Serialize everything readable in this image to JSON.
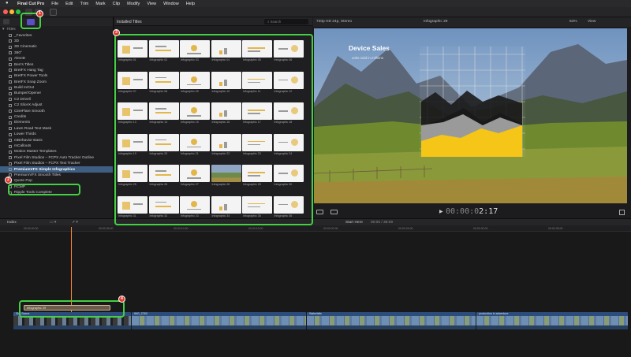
{
  "menubar": {
    "app_name": "Final Cut Pro",
    "items": [
      "File",
      "Edit",
      "Trim",
      "Mark",
      "Clip",
      "Modify",
      "View",
      "Window",
      "Help"
    ]
  },
  "sidebar": {
    "root_label": "Titles",
    "items": [
      "_Favorites",
      "3D",
      "3D Cinematic",
      "360°",
      "AlexID",
      "Ben's Titles",
      "BretFX Hang Tag",
      "BretFX Power Tools",
      "BretFX Snap Zoom",
      "Build In/Out",
      "Bumper/Opener",
      "C2 Drivell",
      "C2 SliceX Adjust",
      "CineFlare Smooth",
      "Credits",
      "Elements",
      "Lawn Road Text Mask",
      "Lower Thirds",
      "mBehavior Basic",
      "mCallouts",
      "Motion Master Templates",
      "Pixel Film Studios – FCPX Auto Tracker Outline",
      "Pixel Film Studios – FCPX Text Tracker",
      "PremiumVFX Simple Infographics",
      "PremiumVFX Smooth Titles",
      "Quote Pop",
      "RCMP",
      "Ripple Tools Complete"
    ],
    "selected_index": 23
  },
  "browser": {
    "title": "Installed Titles",
    "search_placeholder": "Search",
    "tiles": [
      "Infographic 01",
      "Infographic 02",
      "Infographic 03",
      "Infographic 04",
      "Infographic 05",
      "Infographic 06",
      "Infographic 07",
      "Infographic 08",
      "Infographic 09",
      "Infographic 10",
      "Infographic 11",
      "Infographic 12",
      "Infographic 13",
      "Infographic 14",
      "Infographic 15",
      "Infographic 16",
      "Infographic 17",
      "Infographic 18",
      "Infographic 19",
      "Infographic 20",
      "Infographic 21",
      "Infographic 22",
      "Infographic 23",
      "Infographic 24",
      "Infographic 25",
      "Infographic 26",
      "Infographic 27",
      "Infographic 28",
      "Infographic 29",
      "Infographic 30",
      "Infographic 31",
      "Infographic 32",
      "Infographic 33",
      "Infographic 34",
      "Infographic 35",
      "Infographic 36",
      "",
      "",
      "",
      "",
      "",
      ""
    ],
    "photo_tile_index": 27
  },
  "viewer": {
    "format": "720p HD 24p, Stereo",
    "clip_name": "Infographic 29",
    "zoom": "64%",
    "view_menu": "View",
    "info_title": "Device Sales",
    "info_subtitle": "units sold in millions",
    "timecode_dim": "00:00:0",
    "timecode_bright": "2:17"
  },
  "timeline": {
    "index_label": "Index",
    "project_name": "Start Here",
    "project_time": "00:00 / 38:09",
    "ruler_ticks": [
      "00:00:00:00",
      "00:00:05:00",
      "00:00:10:00",
      "00:00:15:00",
      "00:00:20:00",
      "00:00:25:00",
      "00:00:30:00",
      "00:00:35:00"
    ],
    "title_clip_label": "Infographic 29",
    "clips": [
      {
        "label": "Sky-Scene",
        "style": "dark"
      },
      {
        "label": "IMG_2783",
        "style": "normal"
      },
      {
        "label": "Waterfalls",
        "style": "normal"
      },
      {
        "label": "production in adventure",
        "style": "normal"
      }
    ]
  },
  "callouts": [
    "1",
    "2",
    "3",
    "4"
  ],
  "colors": {
    "highlight": "#43d043",
    "badge": "#e23a2e",
    "selection": "#3e5e82",
    "playhead": "#ff8a2a",
    "chart_yellow": "#f5c518",
    "chart_gray": "#9a9a9a",
    "chart_black": "#1a1a1a"
  }
}
